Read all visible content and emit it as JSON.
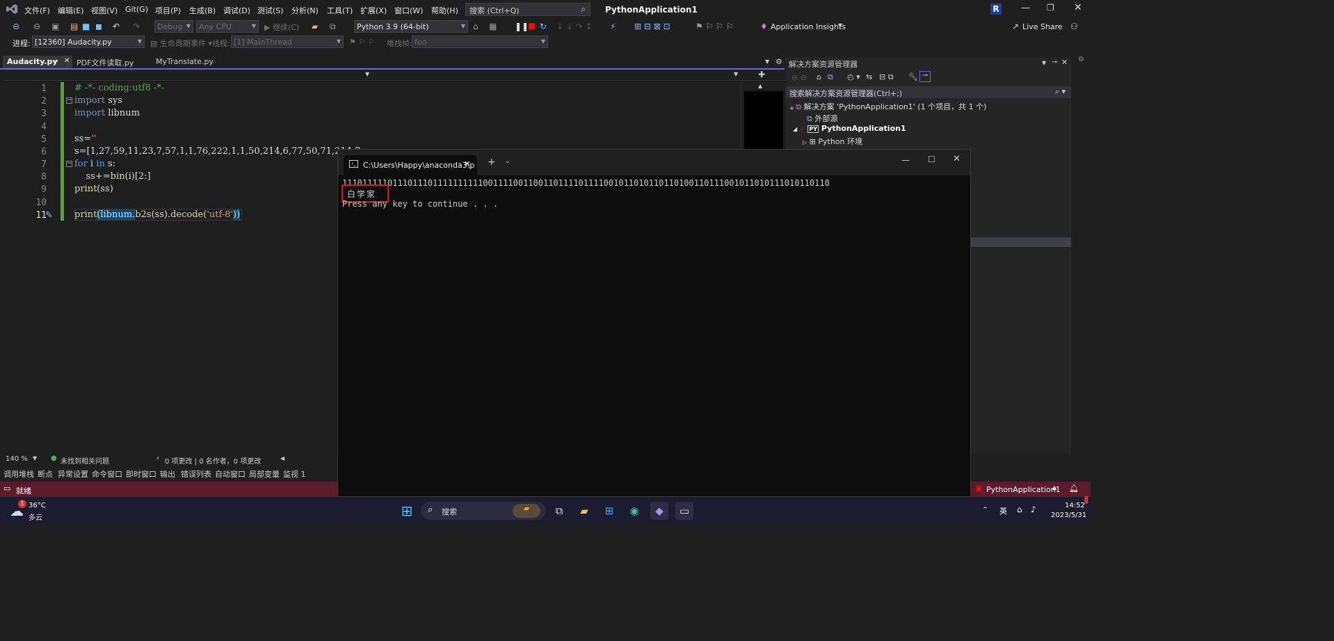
{
  "menubar": {
    "items": [
      "文件(F)",
      "编辑(E)",
      "视图(V)",
      "Git(G)",
      "项目(P)",
      "生成(B)",
      "调试(D)",
      "测试(S)",
      "分析(N)",
      "工具(T)",
      "扩展(X)",
      "窗口(W)",
      "帮助(H)"
    ],
    "search_placeholder": "搜索 (Ctrl+Q)",
    "solution_name": "PythonApplication1",
    "user_initial": "R"
  },
  "toolbar": {
    "config": "Debug",
    "platform": "Any CPU",
    "continue_label": "继续(C)",
    "python_env": "Python 3.9 (64-bit)",
    "insights": "Application Insights",
    "live_share": "Live Share"
  },
  "debugbar": {
    "process_label": "进程:",
    "process_value": "[12360] Audacity.py",
    "lifecycle_label": "生命周期事件",
    "thread_label": "线程:",
    "thread_value": "[1] MainThread",
    "stackframe_label": "堆栈帧:",
    "stackframe_value": "foo"
  },
  "tabs": [
    {
      "label": "Audacity.py"
    },
    {
      "label": "PDF文件读取.py"
    },
    {
      "label": "MyTranslate.py"
    }
  ],
  "editor": {
    "line_numbers": [
      "1",
      "2",
      "3",
      "4",
      "5",
      "6",
      "7",
      "8",
      "9",
      "10",
      "11"
    ],
    "zoom": "140 %",
    "issues": "未找到相关问题",
    "changes": "0 项更改 | 0 名作者，0 项更改"
  },
  "code": {
    "l1": "# -*- coding:utf8 -*-",
    "l2_kw": "import",
    "l2_rest": " sys",
    "l3_kw": "import",
    "l3_rest": " libnum",
    "l5_a": "ss=",
    "l5_b": "''",
    "l6": "s=[1,27,59,11,23,7,57,1,1,76,222,1,1,50,214,6,77,50,71,214,7",
    "l7_kw1": "for",
    "l7_mid": " i ",
    "l7_kw2": "in",
    "l7_rest": " s:",
    "l8_a": "    ss+=",
    "l8_fn": "bin",
    "l8_b": "(i)[2:]",
    "l9_fn": "print",
    "l9_rest": "(ss)",
    "l11_fn": "print",
    "l11_a": "(libnum.",
    "l11_fn2": "b2s",
    "l11_b": "(ss).",
    "l11_fn3": "decode",
    "l11_c": "(",
    "l11_str": "'utf-8'",
    "l11_d": "))"
  },
  "solution_explorer": {
    "title": "解决方案资源管理器",
    "search": "搜索解决方案资源管理器(Ctrl+;)",
    "solution": "解决方案 'PythonApplication1' (1 个项目，共 1 个)",
    "external": "外部源",
    "project": "PythonApplication1",
    "python_env": "Python 环境"
  },
  "console": {
    "tab_title": "C:\\Users\\Happy\\anaconda3\\p",
    "binary": "1110111110111011101111111111001111001100110111101111001011010110110100110111001011010111010110110",
    "result": "白学家",
    "prompt": "Press any key to continue . . ."
  },
  "bottom_tabs": [
    "调用堆栈",
    "断点",
    "异常设置",
    "命令窗口",
    "即时窗口",
    "输出",
    "错误列表",
    "自动窗口",
    "局部变量",
    "监视 1"
  ],
  "statusbar": {
    "ready": "就绪",
    "project": "PythonApplication1"
  },
  "taskbar": {
    "weather_temp": "36°C",
    "weather_desc": "多云",
    "weather_badge": "1",
    "search": "搜索",
    "ime": "英",
    "time": "14:52",
    "date": "2023/5/31"
  },
  "colors": {
    "accent": "#7160e8",
    "statusbar": "#5b1b2c",
    "highlight_box": "#e81123",
    "git_green": "#51a32f"
  }
}
